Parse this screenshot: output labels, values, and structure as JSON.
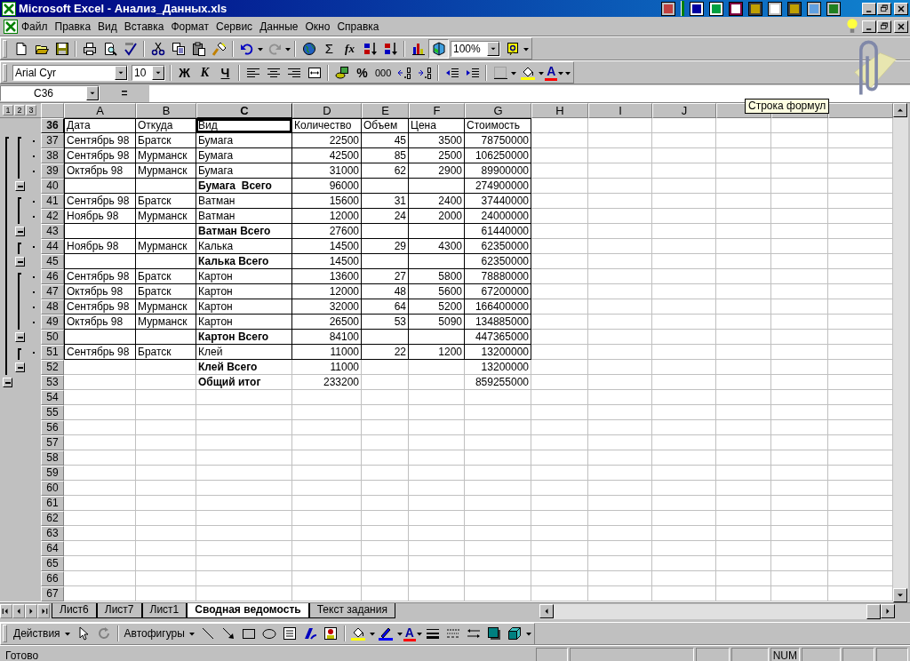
{
  "window": {
    "title": "Microsoft Excel - Анализ_Данных.xls"
  },
  "menu": [
    "Файл",
    "Правка",
    "Вид",
    "Вставка",
    "Формат",
    "Сервис",
    "Данные",
    "Окно",
    "Справка"
  ],
  "standard_toolbar": {
    "autosum": "Σ",
    "function": "fx",
    "zoom": "100%"
  },
  "formatting_toolbar": {
    "font": "Arial Cyr",
    "size": "10",
    "bold": "Ж",
    "italic": "К",
    "underline": "Ч",
    "percent": "%",
    "thousands": "000",
    "font_color": "A"
  },
  "formula_bar": {
    "name_box": "C36",
    "equals": "="
  },
  "tooltip": "Строка формул",
  "outline_levels": [
    "1",
    "2",
    "3"
  ],
  "columns": [
    {
      "label": "A",
      "selected": false
    },
    {
      "label": "B",
      "selected": false
    },
    {
      "label": "C",
      "selected": true
    },
    {
      "label": "D",
      "selected": false
    },
    {
      "label": "E",
      "selected": false
    },
    {
      "label": "F",
      "selected": false
    },
    {
      "label": "G",
      "selected": false
    },
    {
      "label": "H",
      "selected": false
    },
    {
      "label": "I",
      "selected": false
    },
    {
      "label": "J",
      "selected": false
    }
  ],
  "rows": [
    {
      "number": "36",
      "selected": true,
      "kind": "header",
      "bordered": true,
      "cells": [
        "Дата",
        "Откуда",
        "Вид",
        "Количество",
        "Объем",
        "Цена",
        "Стоимость"
      ]
    },
    {
      "number": "37",
      "selected": false,
      "kind": "detail",
      "bordered": true,
      "cells": [
        "Сентябрь 98",
        "Братск",
        "Бумага",
        "22500",
        "45",
        "3500",
        "78750000"
      ]
    },
    {
      "number": "38",
      "selected": false,
      "kind": "detail",
      "bordered": true,
      "cells": [
        "Сентябрь 98",
        "Мурманск",
        "Бумага",
        "42500",
        "85",
        "2500",
        "106250000"
      ]
    },
    {
      "number": "39",
      "selected": false,
      "kind": "detail",
      "bordered": true,
      "cells": [
        "Октябрь 98",
        "Мурманск",
        "Бумага",
        "31000",
        "62",
        "2900",
        "89900000"
      ]
    },
    {
      "number": "40",
      "selected": false,
      "kind": "subtotal",
      "bordered": true,
      "cells": [
        null,
        null,
        "Бумага  Всего",
        "96000",
        null,
        null,
        "274900000"
      ]
    },
    {
      "number": "41",
      "selected": false,
      "kind": "detail",
      "bordered": true,
      "cells": [
        "Сентябрь 98",
        "Братск",
        "Ватман",
        "15600",
        "31",
        "2400",
        "37440000"
      ]
    },
    {
      "number": "42",
      "selected": false,
      "kind": "detail",
      "bordered": true,
      "cells": [
        "Ноябрь 98",
        "Мурманск",
        "Ватман",
        "12000",
        "24",
        "2000",
        "24000000"
      ]
    },
    {
      "number": "43",
      "selected": false,
      "kind": "subtotal",
      "bordered": true,
      "cells": [
        null,
        null,
        "Ватман Всего",
        "27600",
        null,
        null,
        "61440000"
      ]
    },
    {
      "number": "44",
      "selected": false,
      "kind": "detail",
      "bordered": true,
      "cells": [
        "Ноябрь 98",
        "Мурманск",
        "Калька",
        "14500",
        "29",
        "4300",
        "62350000"
      ]
    },
    {
      "number": "45",
      "selected": false,
      "kind": "subtotal",
      "bordered": true,
      "cells": [
        null,
        null,
        "Калька Всего",
        "14500",
        null,
        null,
        "62350000"
      ]
    },
    {
      "number": "46",
      "selected": false,
      "kind": "detail",
      "bordered": true,
      "cells": [
        "Сентябрь 98",
        "Братск",
        "Картон",
        "13600",
        "27",
        "5800",
        "78880000"
      ]
    },
    {
      "number": "47",
      "selected": false,
      "kind": "detail",
      "bordered": true,
      "cells": [
        "Октябрь 98",
        "Братск",
        "Картон",
        "12000",
        "48",
        "5600",
        "67200000"
      ]
    },
    {
      "number": "48",
      "selected": false,
      "kind": "detail",
      "bordered": true,
      "cells": [
        "Сентябрь 98",
        "Мурманск",
        "Картон",
        "32000",
        "64",
        "5200",
        "166400000"
      ]
    },
    {
      "number": "49",
      "selected": false,
      "kind": "detail",
      "bordered": true,
      "cells": [
        "Октябрь 98",
        "Мурманск",
        "Картон",
        "26500",
        "53",
        "5090",
        "134885000"
      ]
    },
    {
      "number": "50",
      "selected": false,
      "kind": "subtotal",
      "bordered": true,
      "cells": [
        null,
        null,
        "Картон Всего",
        "84100",
        null,
        null,
        "447365000"
      ]
    },
    {
      "number": "51",
      "selected": false,
      "kind": "detail",
      "bordered": true,
      "cells": [
        "Сентябрь 98",
        "Братск",
        "Клей",
        "11000",
        "22",
        "1200",
        "13200000"
      ]
    },
    {
      "number": "52",
      "selected": false,
      "kind": "subtotal",
      "bordered": false,
      "cells": [
        null,
        null,
        "Клей Всего",
        "11000",
        null,
        null,
        "13200000"
      ]
    },
    {
      "number": "53",
      "selected": false,
      "kind": "total",
      "bordered": false,
      "cells": [
        null,
        null,
        "Общий итог",
        "233200",
        null,
        null,
        "859255000"
      ]
    },
    {
      "number": "54",
      "selected": false,
      "kind": "empty",
      "bordered": false
    },
    {
      "number": "55",
      "selected": false,
      "kind": "empty",
      "bordered": false
    },
    {
      "number": "56",
      "selected": false,
      "kind": "empty",
      "bordered": false
    },
    {
      "number": "57",
      "selected": false,
      "kind": "empty",
      "bordered": false
    },
    {
      "number": "58",
      "selected": false,
      "kind": "empty",
      "bordered": false
    },
    {
      "number": "59",
      "selected": false,
      "kind": "empty",
      "bordered": false
    },
    {
      "number": "60",
      "selected": false,
      "kind": "empty",
      "bordered": false
    },
    {
      "number": "61",
      "selected": false,
      "kind": "empty",
      "bordered": false
    },
    {
      "number": "62",
      "selected": false,
      "kind": "empty",
      "bordered": false
    },
    {
      "number": "63",
      "selected": false,
      "kind": "empty",
      "bordered": false
    },
    {
      "number": "64",
      "selected": false,
      "kind": "empty",
      "bordered": false
    },
    {
      "number": "65",
      "selected": false,
      "kind": "empty",
      "bordered": false
    },
    {
      "number": "66",
      "selected": false,
      "kind": "empty",
      "bordered": false
    },
    {
      "number": "67",
      "selected": false,
      "kind": "empty",
      "bordered": false
    }
  ],
  "sheet_tabs": [
    {
      "label": "Лист6",
      "selected": false
    },
    {
      "label": "Лист7",
      "selected": false
    },
    {
      "label": "Лист1",
      "selected": false
    },
    {
      "label": "Сводная ведомость",
      "selected": true
    },
    {
      "label": "Текст задания",
      "selected": false
    }
  ],
  "drawing_toolbar": {
    "actions": "Действия",
    "autoshapes": "Автофигуры",
    "font_color": "A"
  },
  "status_bar": {
    "text": "Готово",
    "num": "NUM"
  }
}
